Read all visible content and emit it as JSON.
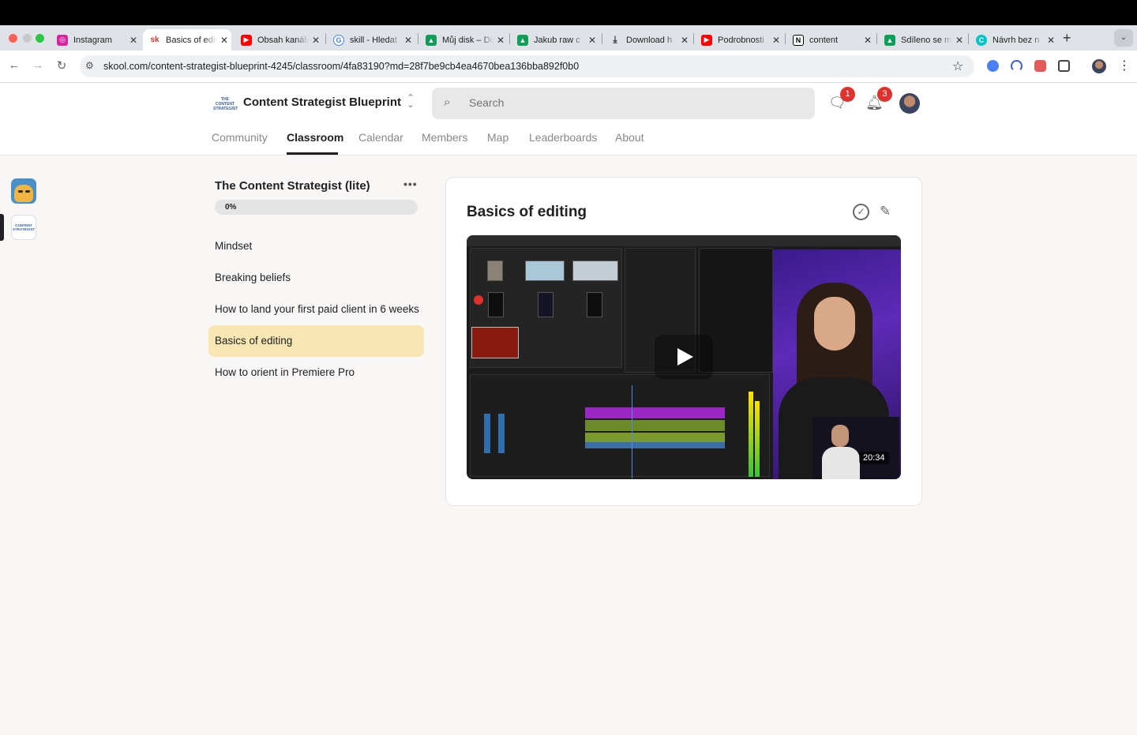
{
  "browser": {
    "tabs": [
      {
        "label": "Instagram",
        "icon": "instagram-icon",
        "color": "#d6249f"
      },
      {
        "label": "Basics of editing",
        "icon": "skool-icon",
        "color": "#ffffff",
        "active": true
      },
      {
        "label": "Obsah kanálu",
        "icon": "youtube-icon",
        "color": "#ff0000"
      },
      {
        "label": "skill - Hledat",
        "icon": "google-icon",
        "color": "#4285f4"
      },
      {
        "label": "Můj disk – Disk",
        "icon": "drive-icon",
        "color": "#0f9d58"
      },
      {
        "label": "Jakub raw c",
        "icon": "drive-icon",
        "color": "#0f9d58"
      },
      {
        "label": "Download h",
        "icon": "download-icon",
        "color": "#333333"
      },
      {
        "label": "Podrobnosti",
        "icon": "youtube-icon",
        "color": "#ff0000"
      },
      {
        "label": "content",
        "icon": "notion-icon",
        "color": "#000000"
      },
      {
        "label": "Sdíleno se m",
        "icon": "drive-icon",
        "color": "#0f9d58"
      },
      {
        "label": "Návrh bez n",
        "icon": "canva-icon",
        "color": "#00c4cc"
      }
    ],
    "url": "skool.com/content-strategist-blueprint-4245/classroom/4fa83190?md=28f7be9cb4ea4670bea136bba892f0b0"
  },
  "header": {
    "logo_text": "THE CONTENT STRATEGIST",
    "group_name": "Content Strategist Blueprint",
    "search_placeholder": "Search",
    "chat_badge": "1",
    "notif_badge": "3",
    "nav": [
      {
        "label": "Community"
      },
      {
        "label": "Classroom",
        "active": true
      },
      {
        "label": "Calendar"
      },
      {
        "label": "Members"
      },
      {
        "label": "Map"
      },
      {
        "label": "Leaderboards"
      },
      {
        "label": "About"
      }
    ]
  },
  "rail": {
    "communities": [
      "cat-community-icon",
      "content-strategist-icon"
    ]
  },
  "course": {
    "title": "The Content Strategist (lite)",
    "progress_label": "0%",
    "progress_value": 0,
    "more": "•••",
    "lessons": [
      {
        "label": "Mindset"
      },
      {
        "label": "Breaking beliefs"
      },
      {
        "label": "How to land your first paid client in 6 weeks"
      },
      {
        "label": "Basics of editing",
        "active": true
      },
      {
        "label": "How to orient in Premiere Pro"
      }
    ]
  },
  "lesson": {
    "title": "Basics of editing",
    "video_duration": "20:34"
  },
  "colors": {
    "accent": "#f8e6b3",
    "badge": "#e0322d",
    "progress_track": "#e4e4e4"
  }
}
